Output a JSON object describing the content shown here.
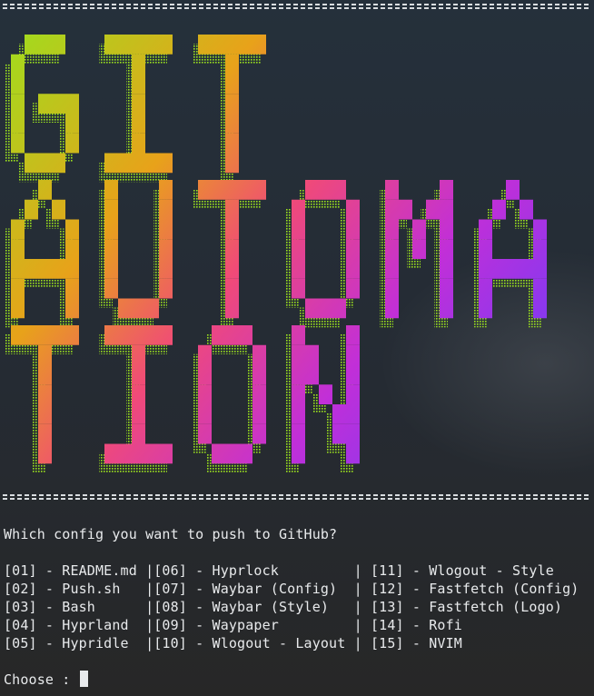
{
  "banner": {
    "lines": [
      "GIT",
      "AUTOMA",
      "TION"
    ],
    "colors": [
      "#9be11e",
      "#e8a21a",
      "#f04a78",
      "#c12fd8",
      "#7a3af5",
      "#4f5bff"
    ]
  },
  "rule": "=================================================================================",
  "prompt": "Which config you want to push to GitHub?",
  "menu_rows": [
    "[01] - README.md |[06] - Hyprlock         | [11] - Wlogout - Style",
    "[02] - Push.sh   |[07] - Waybar (Config)  | [12] - Fastfetch (Config)",
    "[03] - Bash      |[08] - Waybar (Style)   | [13] - Fastfetch (Logo)",
    "[04] - Hyprland  |[09] - Waypaper         | [14] - Rofi",
    "[05] - Hypridle  |[10] - Wlogout - Layout | [15] - NVIM"
  ],
  "choose_label": "Choose : "
}
